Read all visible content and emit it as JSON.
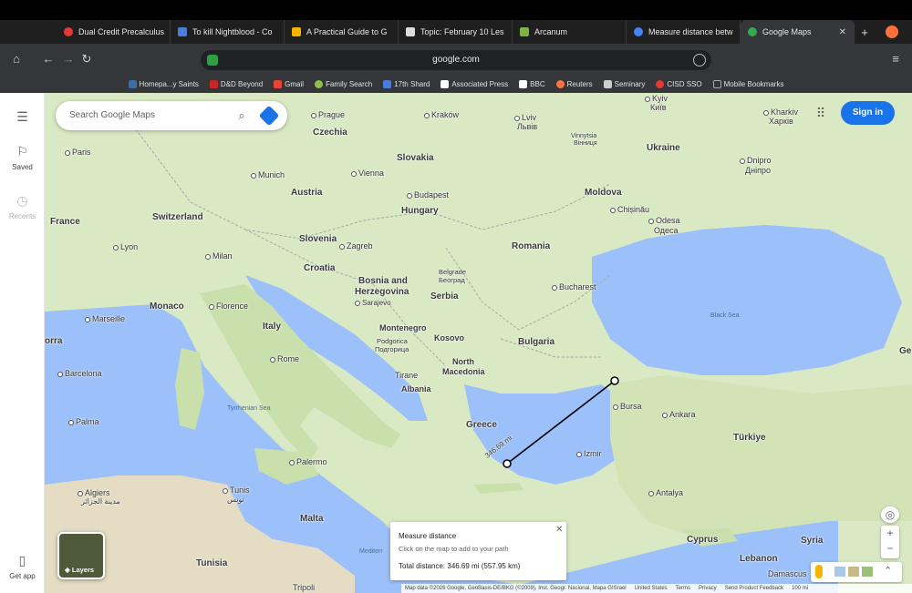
{
  "browser": {
    "tabs": [
      {
        "label": "Dual Credit Precalculus",
        "color": "#e53935"
      },
      {
        "label": "To kill Nightblood - Co",
        "color": "#4a7dd8"
      },
      {
        "label": "A Practical Guide to G",
        "color": "#f4b400"
      },
      {
        "label": "Topic: February 10 Les",
        "color": "#dddddd"
      },
      {
        "label": "Arcanum",
        "color": "#7cb342"
      },
      {
        "label": "Measure distance betw",
        "color": "#4285f4"
      },
      {
        "label": "Google Maps",
        "color": "#34a853"
      }
    ],
    "active_tab_close": "✕",
    "new_tab": "+",
    "url": "google.com",
    "bookmarks": [
      {
        "label": "Homepa...y Saints",
        "color": "#3b6ea5"
      },
      {
        "label": "D&D Beyond",
        "color": "#c62828"
      },
      {
        "label": "Gmail",
        "color": "#ea4335"
      },
      {
        "label": "Family Search",
        "color": "#8bc34a"
      },
      {
        "label": "17th Shard",
        "color": "#4a7dd8"
      },
      {
        "label": "Associated Press",
        "color": "#ffffff"
      },
      {
        "label": "BBC",
        "color": "#ffffff"
      },
      {
        "label": "Reuters",
        "color": "#ff7043"
      },
      {
        "label": "Seminary",
        "color": "#cccccc"
      },
      {
        "label": "CISD SSO",
        "color": "#e53935"
      },
      {
        "label": "Mobile Bookmarks",
        "color": "#aaaaaa"
      }
    ]
  },
  "rail": {
    "saved": "Saved",
    "recents": "Recents",
    "get_app": "Get app"
  },
  "search": {
    "placeholder": "Search Google Maps"
  },
  "signin": "Sign in",
  "measure": {
    "title": "Measure distance",
    "subtitle": "Click on the map to add to your path",
    "total": "Total distance: 346.69 mi (557.95 km)",
    "path_label": "346.69 mi"
  },
  "layers_label": "Layers",
  "footer": {
    "attribution": "Map data ©2026 Google, GeoBasis-DE/BKG (©2009), Inst. Geogr. Nacional, Mapa GISrael",
    "links": [
      "United States",
      "Terms",
      "Privacy",
      "Send Product Feedback"
    ],
    "scale": "100 mi"
  },
  "map_labels": {
    "countries": [
      "Czechia",
      "Slovakia",
      "Ukraine",
      "Austria",
      "Moldova",
      "Switzerland",
      "Hungary",
      "France",
      "Romania",
      "Slovenia",
      "Croatia",
      "Bosnia and",
      "Herzegovina",
      "Serbia",
      "Monaco",
      "Italy",
      "Montenegro",
      "Kosovo",
      "Bulgaria",
      "North",
      "Macedonia",
      "Albania",
      "Greece",
      "Türkiye",
      "Malta",
      "Tunisia",
      "Cyprus",
      "Lebanon",
      "Syria",
      "orra",
      "Ge"
    ],
    "cities": [
      "Prague",
      "Kraków",
      "Kyiv",
      "Київ",
      "Lviv",
      "Львів",
      "Kharkiv",
      "Харків",
      "Paris",
      "Vinnytsia",
      "Вінниця",
      "Dnipro",
      "Дніпро",
      "Munich",
      "Vienna",
      "Budapest",
      "Chișinău",
      "Odesa",
      "Одеса",
      "Lyon",
      "Zagreb",
      "Milan",
      "Belgrade",
      "Београд",
      "Bucharest",
      "Florence",
      "Sarajevo",
      "Marseille",
      "Podgorica",
      "Подгорица",
      "Rome",
      "Barcelona",
      "Tirane",
      "Bursa",
      "Ankara",
      "Palma",
      "Izmir",
      "Palermo",
      "Algiers",
      "مدينة الجزائر",
      "Tunis",
      "تونس",
      "Antalya",
      "Tripoli",
      "Damascus",
      "Mediterr"
    ],
    "seas": [
      "Black Sea",
      "Tyrrhenian Sea"
    ]
  }
}
